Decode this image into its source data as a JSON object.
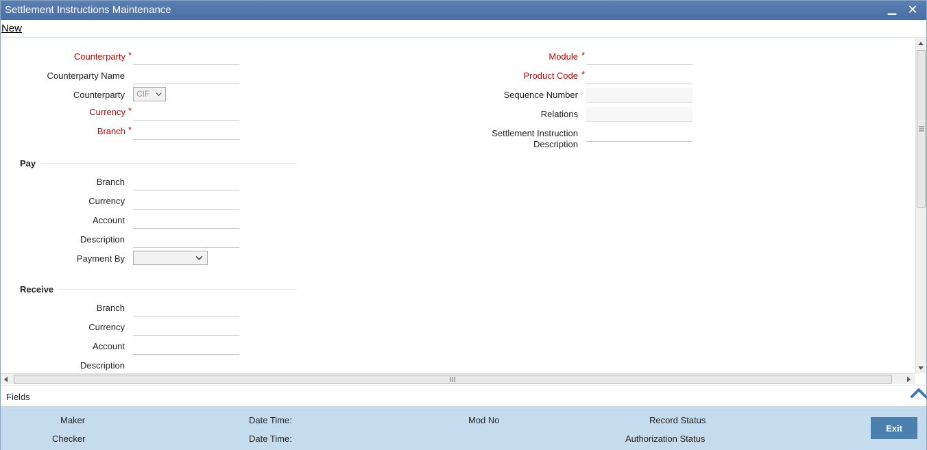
{
  "window": {
    "title": "Settlement Instructions Maintenance",
    "minimize_glyph": "▁",
    "close_glyph": "✕"
  },
  "toolbar": {
    "new_label": "New"
  },
  "left_fields": {
    "counterparty_label": "Counterparty",
    "counterparty_name_label": "Counterparty Name",
    "counterparty_type_label": "Counterparty",
    "counterparty_type_value": "CIF",
    "currency_label": "Currency",
    "branch_label": "Branch",
    "required_mark": "*"
  },
  "right_fields": {
    "module_label": "Module",
    "product_code_label": "Product Code",
    "sequence_number_label": "Sequence Number",
    "relations_label": "Relations",
    "settlement_desc_label_line1": "Settlement Instruction",
    "settlement_desc_label_line2": "Description"
  },
  "pay": {
    "header": "Pay",
    "branch_label": "Branch",
    "currency_label": "Currency",
    "account_label": "Account",
    "description_label": "Description",
    "payment_by_label": "Payment By",
    "payment_by_value": ""
  },
  "receive": {
    "header": "Receive",
    "branch_label": "Branch",
    "currency_label": "Currency",
    "account_label": "Account",
    "description_label": "Description"
  },
  "fields_bar": {
    "label": "Fields"
  },
  "footer": {
    "maker_label": "Maker",
    "checker_label": "Checker",
    "date_time_label_1": "Date Time:",
    "date_time_label_2": "Date Time:",
    "mod_no_label": "Mod No",
    "record_status_label": "Record Status",
    "authorization_status_label": "Authorization Status",
    "exit_label": "Exit"
  },
  "colors": {
    "titlebar": "#4a6fa5",
    "required": "#cc0000",
    "footer_bg": "#c5dcee",
    "exit_button": "#4a7fae"
  },
  "icons": {
    "minimize": "minimize-icon",
    "close": "close-icon",
    "dropdown": "chevron-down-icon",
    "collapse": "chevron-up-icon"
  }
}
